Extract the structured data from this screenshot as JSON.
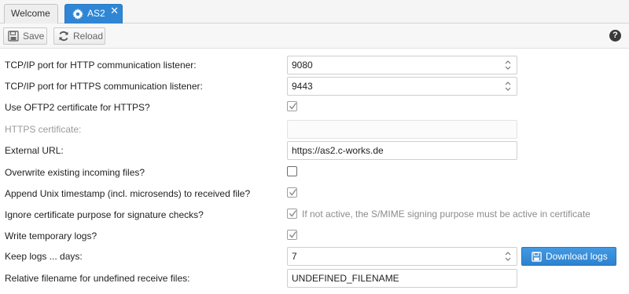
{
  "tabs": [
    {
      "label": "Welcome"
    },
    {
      "label": "AS2",
      "close": "✕"
    }
  ],
  "toolbar": {
    "save_label": "Save",
    "reload_label": "Reload",
    "help_glyph": "?"
  },
  "form": {
    "http_port": {
      "label": "TCP/IP port for HTTP communication listener:",
      "value": "9080"
    },
    "https_port": {
      "label": "TCP/IP port for HTTPS communication listener:",
      "value": "9443"
    },
    "use_oftp2_cert": {
      "label": "Use OFTP2 certificate for HTTPS?",
      "checked": true
    },
    "https_cert": {
      "label": "HTTPS certificate:",
      "value": ""
    },
    "external_url": {
      "label": "External URL:",
      "value": "https://as2.c-works.de"
    },
    "overwrite_files": {
      "label": "Overwrite existing incoming files?",
      "checked": false
    },
    "append_timestamp": {
      "label": "Append Unix timestamp (incl. microsends) to received file?",
      "checked": true
    },
    "ignore_cert_purpose": {
      "label": "Ignore certificate purpose for signature checks?",
      "checked": true,
      "note": "If not active, the S/MIME signing purpose must be active in certificate"
    },
    "temp_logs": {
      "label": "Write temporary logs?",
      "checked": true
    },
    "keep_logs": {
      "label": "Keep logs ... days:",
      "value": "7",
      "button": "Download logs"
    },
    "undefined_filename": {
      "label": "Relative filename for undefined receive files:",
      "value": "UNDEFINED_FILENAME"
    }
  },
  "colors": {
    "accent": "#2f86d5",
    "tab_active_text": "#ffffff"
  }
}
